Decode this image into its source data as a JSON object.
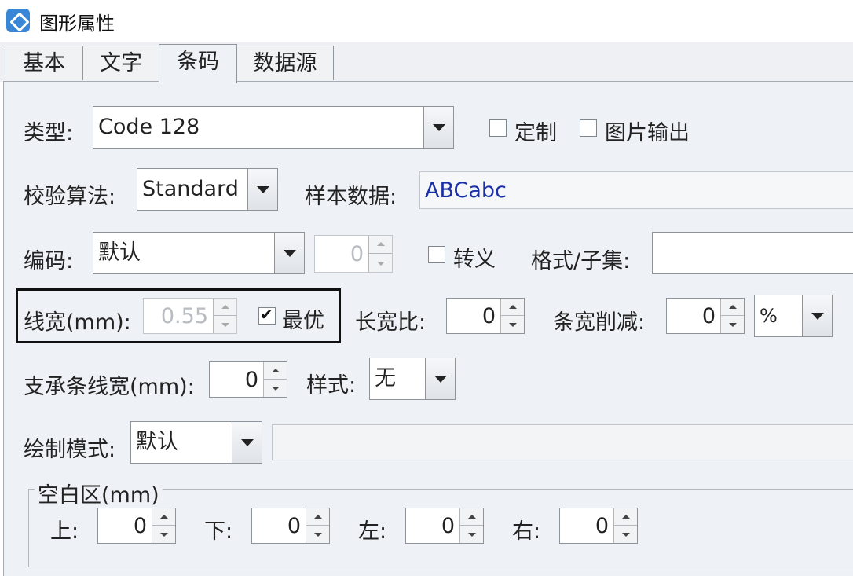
{
  "window": {
    "title": "图形属性"
  },
  "tabs": [
    {
      "label": "基本"
    },
    {
      "label": "文字"
    },
    {
      "label": "条码"
    },
    {
      "label": "数据源"
    }
  ],
  "active_tab": "条码",
  "barcode": {
    "type": {
      "label": "类型:",
      "value": "Code 128"
    },
    "custom": {
      "label": "定制",
      "checked": false
    },
    "image_output": {
      "label": "图片输出",
      "checked": false
    },
    "checksum": {
      "label": "校验算法:",
      "value": "Standard"
    },
    "sample_data": {
      "label": "样本数据:",
      "value": "ABCabc",
      "color": "#1a2fa8"
    },
    "encoding": {
      "label": "编码:",
      "value": "默认"
    },
    "encoding_spin": {
      "value": "0"
    },
    "escape": {
      "label": "转义",
      "checked": false
    },
    "format_subset": {
      "label": "格式/子集:",
      "value": ""
    },
    "line_width": {
      "label": "线宽(mm):",
      "value": "0.55"
    },
    "optimal": {
      "label": "最优",
      "checked": true
    },
    "aspect_ratio": {
      "label": "长宽比:",
      "value": "0"
    },
    "bar_reduction": {
      "label": "条宽削减:",
      "value": "0",
      "unit": "%"
    },
    "bearer_width": {
      "label": "支承条线宽(mm):",
      "value": "0"
    },
    "style": {
      "label": "样式:",
      "value": "无"
    },
    "draw_mode": {
      "label": "绘制模式:",
      "value": "默认",
      "extra": ""
    },
    "quiet_zone": {
      "title": "空白区(mm)",
      "top": {
        "label": "上:",
        "value": "0"
      },
      "bottom": {
        "label": "下:",
        "value": "0"
      },
      "left": {
        "label": "左:",
        "value": "0"
      },
      "right": {
        "label": "右:",
        "value": "0"
      }
    }
  },
  "icons": {
    "app": "app-logo-icon",
    "dropdown": "chevron-down-icon"
  }
}
